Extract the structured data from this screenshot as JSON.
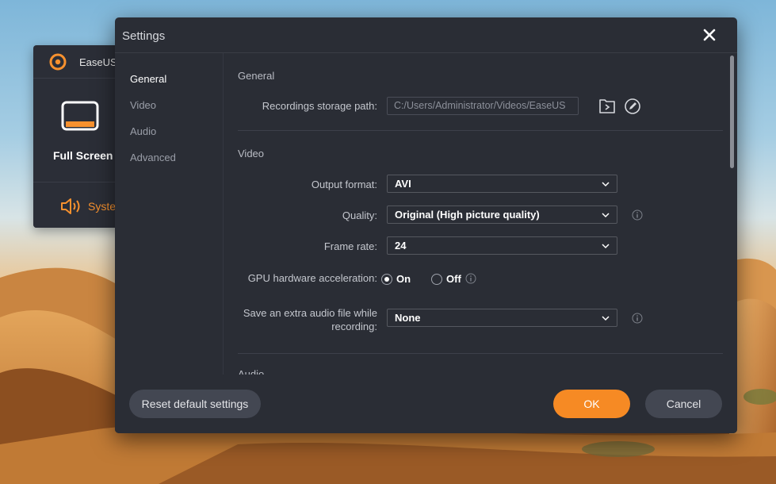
{
  "background_app": {
    "brand": "EaseUS",
    "mode_label": "Full Screen",
    "audio_label": "Syste"
  },
  "dialog": {
    "title": "Settings",
    "nav": [
      "General",
      "Video",
      "Audio",
      "Advanced"
    ],
    "active_nav": "General",
    "general": {
      "section_title": "General",
      "storage_label": "Recordings storage path:",
      "storage_path": "C:/Users/Administrator/Videos/EaseUS"
    },
    "video": {
      "section_title": "Video",
      "output_format_label": "Output format:",
      "output_format_value": "AVI",
      "quality_label": "Quality:",
      "quality_value": "Original (High picture quality)",
      "frame_rate_label": "Frame rate:",
      "frame_rate_value": "24",
      "gpu_label": "GPU hardware acceleration:",
      "gpu_on": "On",
      "gpu_off": "Off",
      "gpu_selected": "On",
      "extra_audio_label": "Save an extra audio file while recording:",
      "extra_audio_value": "None"
    },
    "next_section_partial": "Audio",
    "footer": {
      "reset_label": "Reset default settings",
      "ok_label": "OK",
      "cancel_label": "Cancel"
    }
  },
  "colors": {
    "accent": "#f68a24",
    "dialog_bg": "#2a2d35",
    "text_primary": "#ffffff"
  },
  "icons": {
    "close": "close-icon",
    "folder": "open-folder-icon",
    "edit": "edit-pen-icon",
    "info": "info-icon",
    "chevron": "chevron-down-icon"
  }
}
